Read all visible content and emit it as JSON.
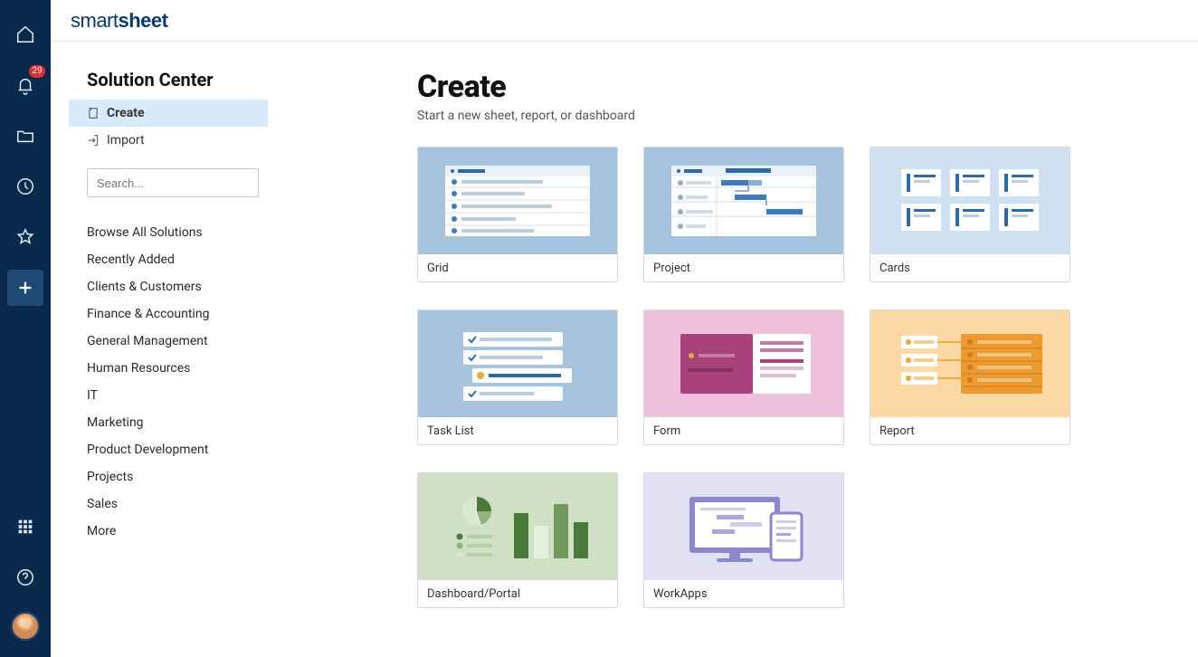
{
  "brand": {
    "thin": "smart",
    "bold": "sheet"
  },
  "rail": {
    "notification_count": "29"
  },
  "sidebar": {
    "title": "Solution Center",
    "modes": {
      "create": "Create",
      "import": "Import"
    },
    "search_placeholder": "Search...",
    "categories": [
      "Browse All Solutions",
      "Recently Added",
      "Clients & Customers",
      "Finance & Accounting",
      "General Management",
      "Human Resources",
      "IT",
      "Marketing",
      "Product Development",
      "Projects",
      "Sales",
      "More"
    ]
  },
  "main": {
    "title": "Create",
    "subtitle": "Start a new sheet, report, or dashboard",
    "tiles": [
      {
        "label": "Grid"
      },
      {
        "label": "Project"
      },
      {
        "label": "Cards"
      },
      {
        "label": "Task List"
      },
      {
        "label": "Form"
      },
      {
        "label": "Report"
      },
      {
        "label": "Dashboard/Portal"
      },
      {
        "label": "WorkApps"
      }
    ]
  }
}
